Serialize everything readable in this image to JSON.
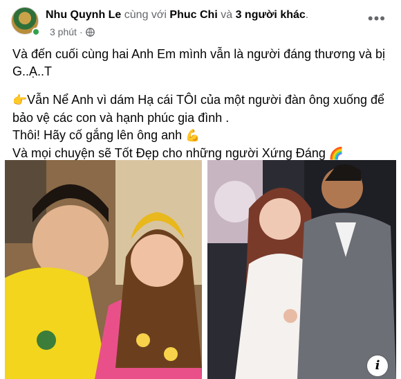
{
  "header": {
    "author": "Nhu Quynh Le",
    "with_text": "cùng với",
    "tagged_name": "Phuc Chi",
    "and_text": "và",
    "others": "3 người khác",
    "period": ".",
    "timestamp": "3 phút",
    "dot": "·",
    "more_icon": "ellipsis-icon",
    "privacy_icon": "globe-icon",
    "online": true
  },
  "post": {
    "line1": "Và đến cuối cùng hai Anh Em  mình vẫn là người đáng thương và bị",
    "line2": "G..Ạ..T",
    "line3_emoji": "👉",
    "line3": "Vẫn Nể Anh vì dám Hạ cái TÔI của một người đàn ông xuống để",
    "line4": "bảo vệ các con và hạnh phúc gia đình .",
    "line5": "Thôi! Hãy cố gắng lên ông anh",
    "line5_emoji": "💪",
    "line6": "Và mọi chuyện sẽ Tốt Đẹp cho những người Xứng  Đáng",
    "line6_emoji": "🌈"
  },
  "photos": {
    "count": 2,
    "info_label": "i"
  }
}
